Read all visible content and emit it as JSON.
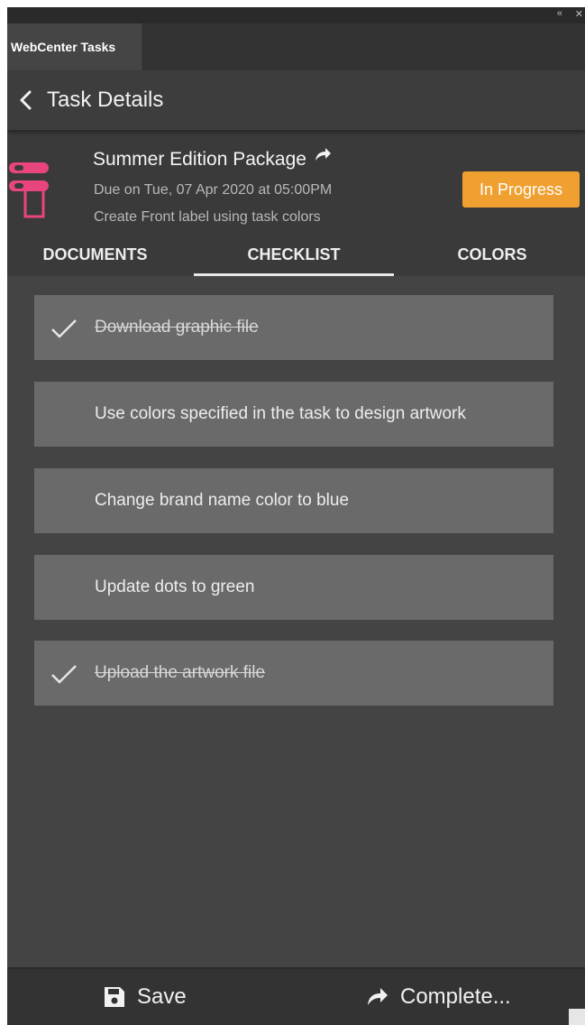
{
  "window": {
    "collapse_glyph": "«",
    "close_glyph": "✕"
  },
  "panel_tab": {
    "label": "WebCenter Tasks"
  },
  "header": {
    "title": "Task Details",
    "back_icon": "chevron-left-icon"
  },
  "task": {
    "name": "Summer Edition Package",
    "due": "Due on Tue, 07 Apr 2020 at 05:00PM",
    "description": "Create Front label using task colors",
    "status": "In Progress",
    "status_color": "#f0a030",
    "logo_color": "#e8457f"
  },
  "tabs": [
    {
      "label": "DOCUMENTS",
      "active": false
    },
    {
      "label": "CHECKLIST",
      "active": true
    },
    {
      "label": "COLORS",
      "active": false
    }
  ],
  "checklist": [
    {
      "label": "Download graphic file",
      "done": true
    },
    {
      "label": "Use colors specified in the task to design artwork",
      "done": false
    },
    {
      "label": "Change brand name color to blue",
      "done": false
    },
    {
      "label": "Update dots to green",
      "done": false
    },
    {
      "label": "Upload the artwork file",
      "done": true
    }
  ],
  "footer": {
    "save_label": "Save",
    "save_icon": "floppy-disk-icon",
    "complete_label": "Complete...",
    "complete_icon": "share-arrow-icon"
  }
}
